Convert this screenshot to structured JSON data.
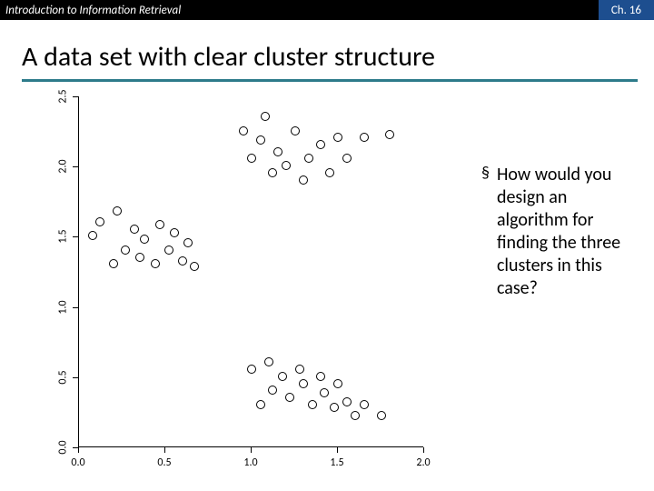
{
  "header": {
    "left": "Introduction to Information Retrieval",
    "right": "Ch. 16"
  },
  "title": "A data set with clear cluster structure",
  "bullet": {
    "mark": "§",
    "text": "How would you design an algorithm for finding the three clusters in this case?"
  },
  "chart_data": {
    "type": "scatter",
    "title": "",
    "xlabel": "",
    "ylabel": "",
    "xlim": [
      0.0,
      2.0
    ],
    "ylim": [
      0.0,
      2.5
    ],
    "xticks": [
      0.0,
      0.5,
      1.0,
      1.5,
      2.0
    ],
    "yticks": [
      0.0,
      0.5,
      1.0,
      1.5,
      2.0,
      2.5
    ],
    "points": [
      [
        0.08,
        1.5
      ],
      [
        0.12,
        1.6
      ],
      [
        0.2,
        1.3
      ],
      [
        0.22,
        1.68
      ],
      [
        0.27,
        1.4
      ],
      [
        0.32,
        1.55
      ],
      [
        0.35,
        1.35
      ],
      [
        0.38,
        1.48
      ],
      [
        0.44,
        1.3
      ],
      [
        0.47,
        1.58
      ],
      [
        0.52,
        1.4
      ],
      [
        0.55,
        1.52
      ],
      [
        0.6,
        1.32
      ],
      [
        0.63,
        1.45
      ],
      [
        0.67,
        1.28
      ],
      [
        0.95,
        2.25
      ],
      [
        1.0,
        2.05
      ],
      [
        1.05,
        2.18
      ],
      [
        1.08,
        2.35
      ],
      [
        1.12,
        1.95
      ],
      [
        1.15,
        2.1
      ],
      [
        1.2,
        2.0
      ],
      [
        1.25,
        2.25
      ],
      [
        1.3,
        1.9
      ],
      [
        1.33,
        2.05
      ],
      [
        1.4,
        2.15
      ],
      [
        1.45,
        1.95
      ],
      [
        1.5,
        2.2
      ],
      [
        1.55,
        2.05
      ],
      [
        1.65,
        2.2
      ],
      [
        1.8,
        2.22
      ],
      [
        1.0,
        0.55
      ],
      [
        1.05,
        0.3
      ],
      [
        1.1,
        0.6
      ],
      [
        1.12,
        0.4
      ],
      [
        1.18,
        0.5
      ],
      [
        1.22,
        0.35
      ],
      [
        1.28,
        0.55
      ],
      [
        1.3,
        0.45
      ],
      [
        1.35,
        0.3
      ],
      [
        1.4,
        0.5
      ],
      [
        1.42,
        0.38
      ],
      [
        1.48,
        0.28
      ],
      [
        1.5,
        0.45
      ],
      [
        1.55,
        0.32
      ],
      [
        1.6,
        0.22
      ],
      [
        1.65,
        0.3
      ],
      [
        1.75,
        0.22
      ]
    ]
  },
  "axis_labels": {
    "x": [
      "0.0",
      "0.5",
      "1.0",
      "1.5",
      "2.0"
    ],
    "y": [
      "0.0",
      "0.5",
      "1.0",
      "1.5",
      "2.0",
      "2.5"
    ]
  }
}
